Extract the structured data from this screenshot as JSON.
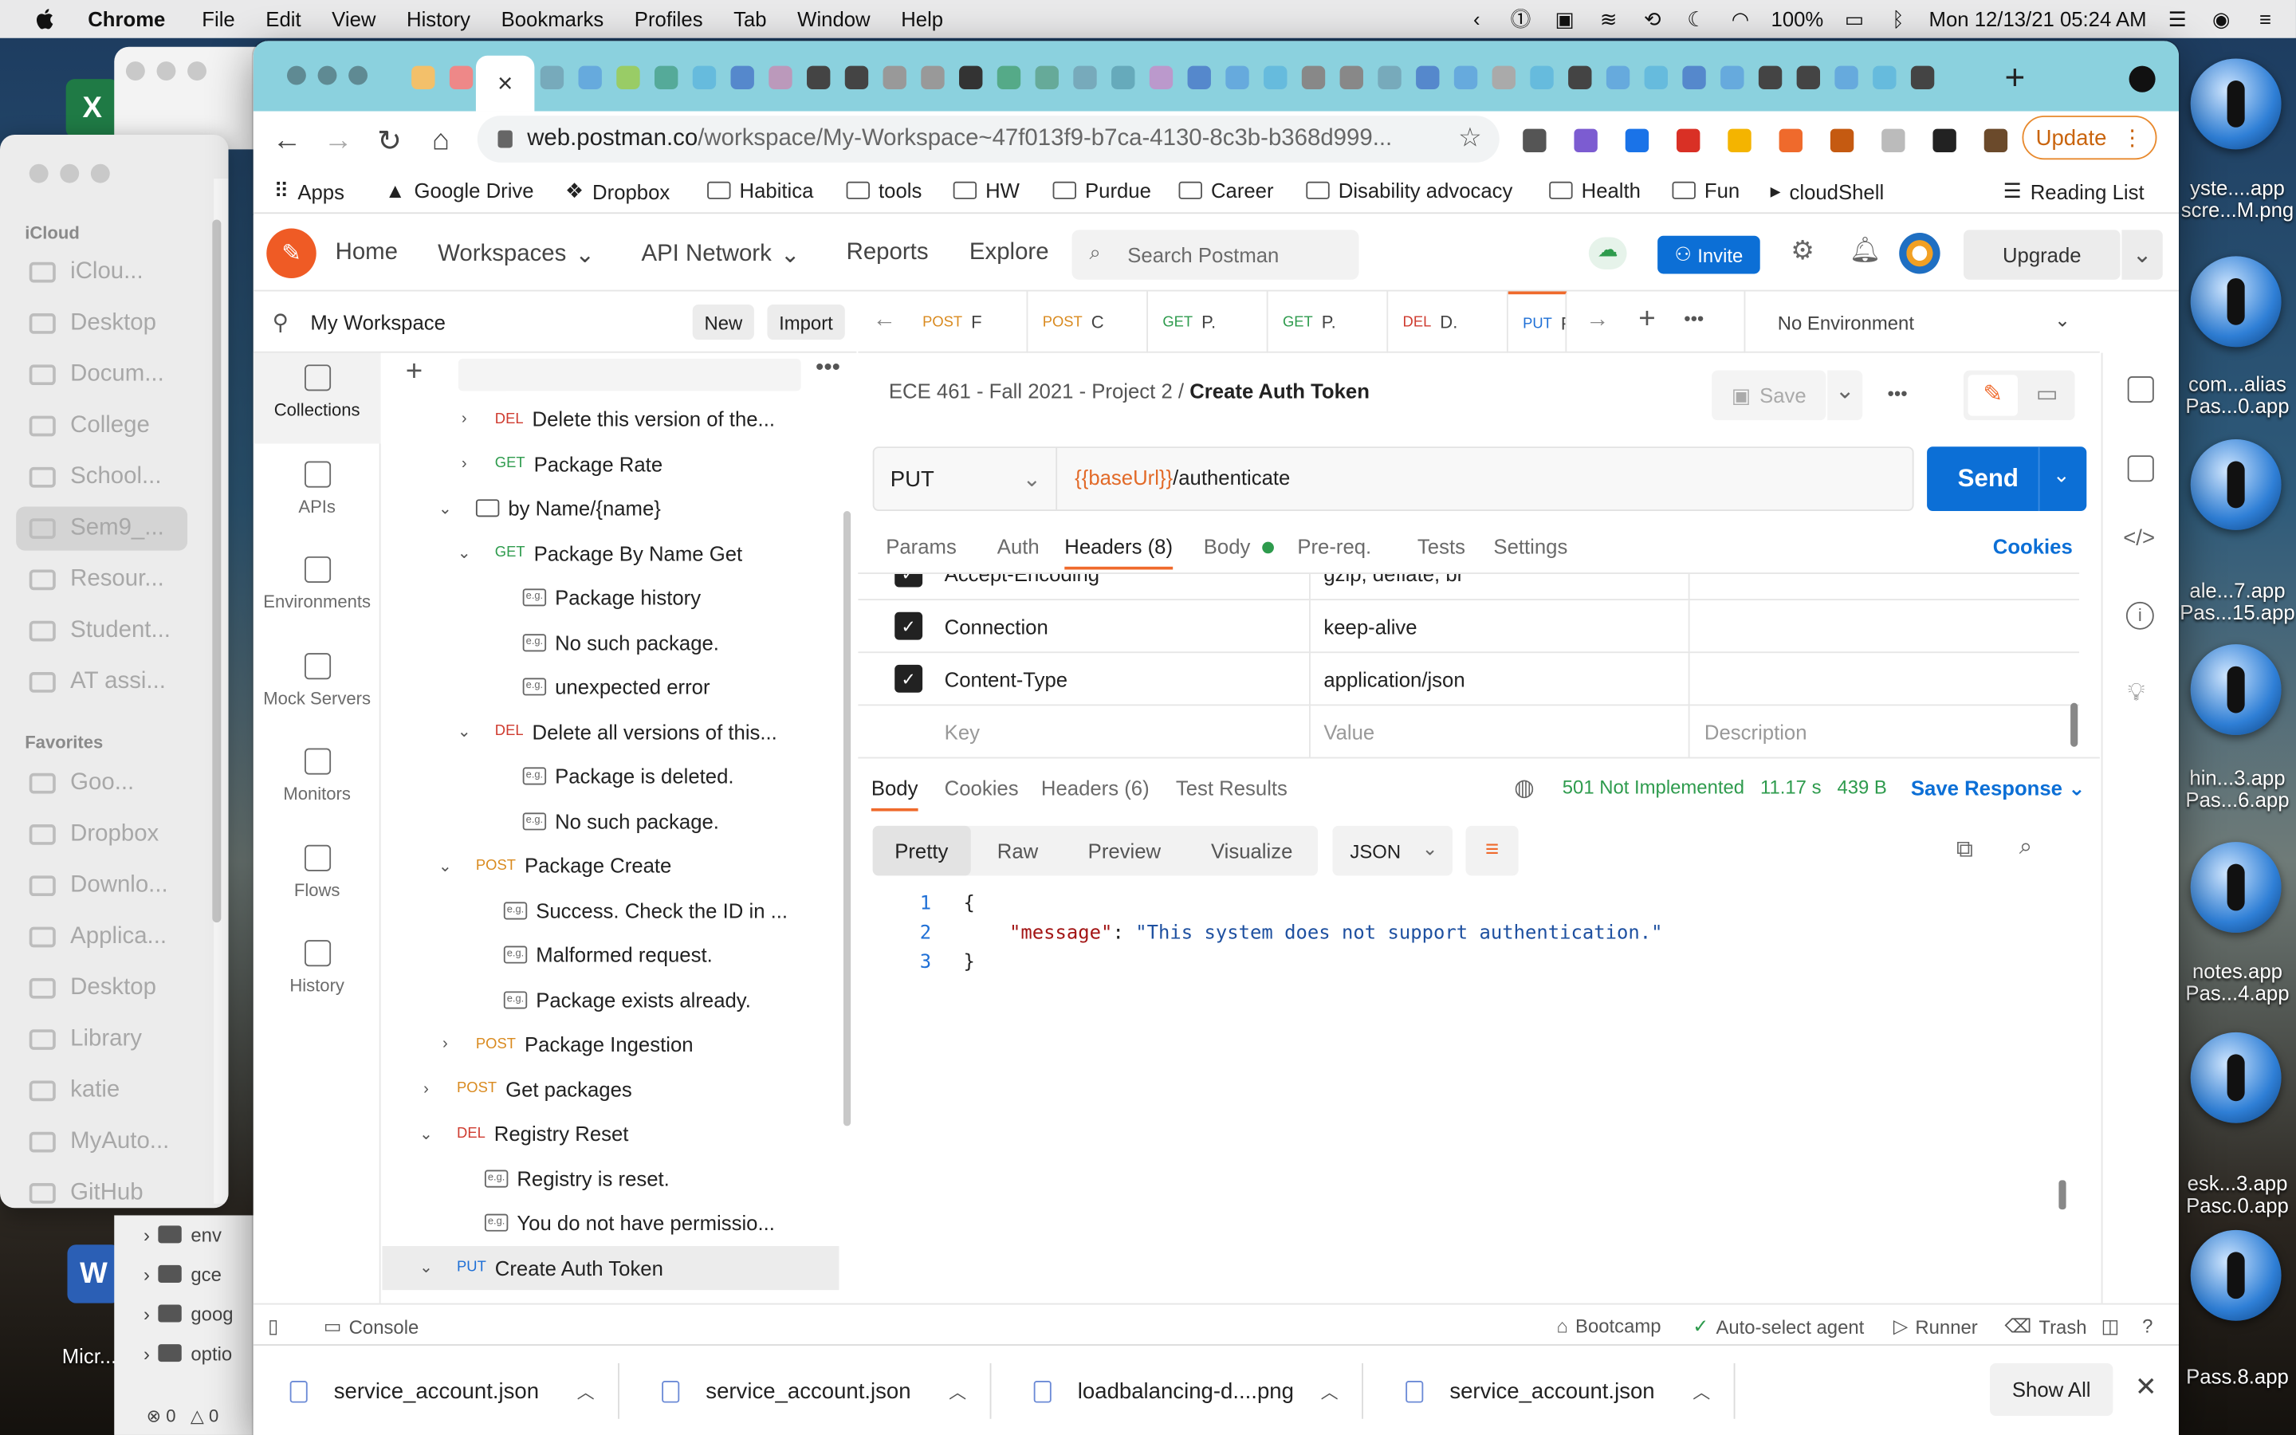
{
  "menubar": {
    "app": "Chrome",
    "items": [
      "File",
      "Edit",
      "View",
      "History",
      "Bookmarks",
      "Profiles",
      "Tab",
      "Window",
      "Help"
    ],
    "battery": "100%",
    "clock": "Mon 12/13/21  05:24 AM"
  },
  "finder": {
    "section_icloud": "iCloud",
    "section_favorites": "Favorites",
    "items": [
      "iClou...",
      "Desktop",
      "Docum...",
      "College",
      "School...",
      "Sem9_...",
      "Resour...",
      "Student...",
      "AT assi..."
    ],
    "favorites": [
      "Goo...",
      "Dropbox",
      "Downlo...",
      "Applica...",
      "Desktop",
      "Library",
      "katie",
      "MyAuto...",
      "GitHub"
    ]
  },
  "filewin": {
    "rows": [
      "env",
      "gce",
      "goog",
      "optio"
    ],
    "counts": [
      "0",
      "0"
    ]
  },
  "desktop": {
    "labels": [
      "yste....app",
      "scre...M.png",
      "com...alias",
      "Pas...0.app",
      "ale...7.app",
      "Pas...15.app",
      "hin...3.app",
      "Pas...6.app",
      "notes.app",
      "Pas...4.app",
      "esk...3.app",
      "Pasc.0.app",
      "Pass.8.app"
    ],
    "excel_label": "X",
    "word_label": "W",
    "word_caption": "Micr..."
  },
  "chrome": {
    "active_tab_close": "×",
    "url_host": "web.postman.co",
    "url_path": "/workspace/My-Workspace~47f013f9-b7ca-4130-8c3b-b368d999...",
    "update_label": "Update",
    "bookmarks": [
      "Apps",
      "Google Drive",
      "Dropbox",
      "Habitica",
      "tools",
      "HW",
      "Purdue",
      "Career",
      "Disability advocacy",
      "Health",
      "Fun",
      "cloudShell"
    ],
    "reading_list": "Reading List"
  },
  "postman": {
    "nav": {
      "home": "Home",
      "workspaces": "Workspaces",
      "api_network": "API Network",
      "reports": "Reports",
      "explore": "Explore",
      "search_placeholder": "Search Postman",
      "invite": "Invite",
      "upgrade": "Upgrade"
    },
    "workspace": {
      "name": "My Workspace",
      "new": "New",
      "import": "Import"
    },
    "rail": [
      "Collections",
      "APIs",
      "Environments",
      "Mock Servers",
      "Monitors",
      "Flows",
      "History"
    ],
    "tree": [
      {
        "kind": "req",
        "method": "DEL",
        "label": "Delete this version of the...",
        "chev": "›"
      },
      {
        "kind": "req",
        "method": "GET",
        "label": "Package Rate",
        "chev": "›"
      },
      {
        "kind": "folder",
        "method": "",
        "label": "by Name/{name}",
        "chev": "⌄"
      },
      {
        "kind": "req",
        "method": "GET",
        "label": "Package By Name Get",
        "chev": "⌄"
      },
      {
        "kind": "eg",
        "method": "",
        "label": "Package history",
        "chev": ""
      },
      {
        "kind": "eg",
        "method": "",
        "label": "No such package.",
        "chev": ""
      },
      {
        "kind": "eg",
        "method": "",
        "label": "unexpected error",
        "chev": ""
      },
      {
        "kind": "req",
        "method": "DEL",
        "label": "Delete all versions of this...",
        "chev": "⌄"
      },
      {
        "kind": "eg",
        "method": "",
        "label": "Package is deleted.",
        "chev": ""
      },
      {
        "kind": "eg",
        "method": "",
        "label": "No such package.",
        "chev": ""
      },
      {
        "kind": "req",
        "method": "POST",
        "label": "Package Create",
        "chev": "⌄"
      },
      {
        "kind": "eg",
        "method": "",
        "label": "Success. Check the ID in ...",
        "chev": ""
      },
      {
        "kind": "eg",
        "method": "",
        "label": "Malformed request.",
        "chev": ""
      },
      {
        "kind": "eg",
        "method": "",
        "label": "Package exists already.",
        "chev": ""
      },
      {
        "kind": "req",
        "method": "POST",
        "label": "Package Ingestion",
        "chev": "›"
      },
      {
        "kind": "req",
        "method": "POST",
        "label": "Get packages",
        "chev": "›"
      },
      {
        "kind": "req",
        "method": "DEL",
        "label": "Registry Reset",
        "chev": "⌄"
      },
      {
        "kind": "eg",
        "method": "",
        "label": "Registry is reset.",
        "chev": ""
      },
      {
        "kind": "eg",
        "method": "",
        "label": "You do not have permissio...",
        "chev": ""
      },
      {
        "kind": "req",
        "method": "PUT",
        "label": "Create Auth Token",
        "chev": "⌄"
      }
    ],
    "open_tabs": [
      {
        "method": "POST",
        "label": "F"
      },
      {
        "method": "POST",
        "label": "C"
      },
      {
        "method": "GET",
        "label": "P."
      },
      {
        "method": "GET",
        "label": "P."
      },
      {
        "method": "DEL",
        "label": "D."
      },
      {
        "method": "PUT",
        "label": "F"
      }
    ],
    "environment": "No Environment",
    "breadcrumb_parent": "ECE 461 - Fall 2021 - Project 2",
    "breadcrumb_sep": "/",
    "breadcrumb_current": "Create Auth Token",
    "save": "Save",
    "request": {
      "method": "PUT",
      "url_var": "{{baseUrl}}",
      "url_path": "/authenticate",
      "send": "Send"
    },
    "req_tabs": [
      "Params",
      "Auth",
      "Headers (8)",
      "Body",
      "Pre-req.",
      "Tests",
      "Settings"
    ],
    "cookies": "Cookies",
    "headers": [
      {
        "key": "Accept-Encoding",
        "value": "gzip, deflate, br",
        "checked": true
      },
      {
        "key": "Connection",
        "value": "keep-alive",
        "checked": true
      },
      {
        "key": "Content-Type",
        "value": "application/json",
        "checked": true
      }
    ],
    "header_placeholders": {
      "key": "Key",
      "value": "Value",
      "desc": "Description"
    },
    "response": {
      "tabs": [
        "Body",
        "Cookies",
        "Headers (6)",
        "Test Results"
      ],
      "status": "501 Not Implemented",
      "time": "11.17 s",
      "size": "439 B",
      "save_response": "Save Response",
      "views": [
        "Pretty",
        "Raw",
        "Preview",
        "Visualize"
      ],
      "format": "JSON",
      "lines": [
        {
          "n": "1",
          "text": "{"
        },
        {
          "n": "2",
          "key": "\"message\"",
          "sep": ": ",
          "val": "\"This system does not support authentication.\""
        },
        {
          "n": "3",
          "text": "}"
        }
      ]
    },
    "footer": {
      "console": "Console",
      "bootcamp": "Bootcamp",
      "agent": "Auto-select agent",
      "runner": "Runner",
      "trash": "Trash"
    }
  },
  "downloads": {
    "files": [
      "service_account.json",
      "service_account.json",
      "loadbalancing-d....png",
      "service_account.json"
    ],
    "show_all": "Show All"
  }
}
